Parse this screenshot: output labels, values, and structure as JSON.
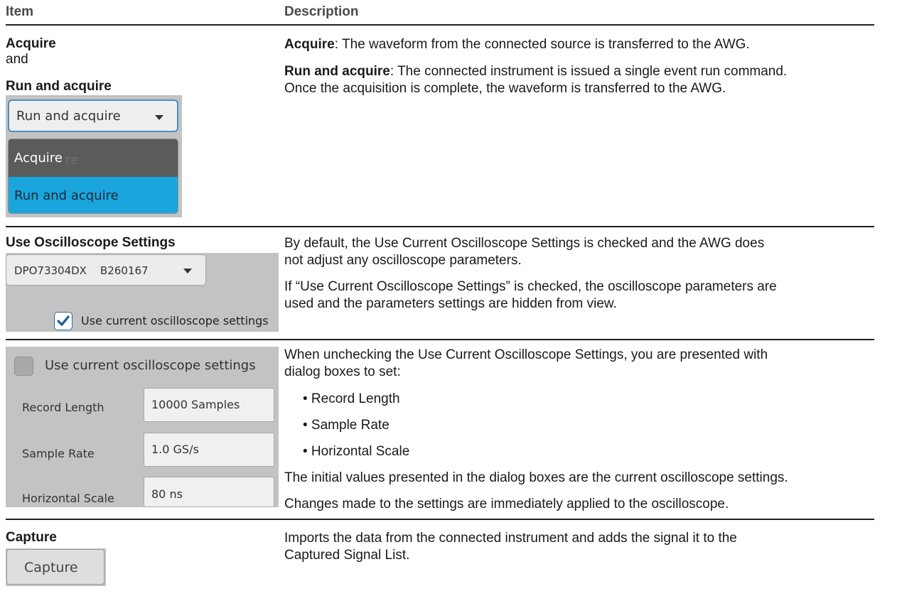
{
  "header": {
    "item": "Item",
    "description": "Description"
  },
  "row1": {
    "title1": "Acquire",
    "and": "and",
    "title2": "Run and acquire",
    "dropdown_value": "Run and acquire",
    "options": [
      "Acquire",
      "Run and acquire"
    ],
    "ghost_text": "re",
    "desc1_bold": "Acquire",
    "desc1_rest": ": The waveform from the connected source is transferred to the AWG.",
    "desc2_bold": "Run and acquire",
    "desc2_line1": ": The connected instrument is issued a single event run command.",
    "desc2_line2": "Once the acquisition is complete, the waveform is transferred to the AWG."
  },
  "row2": {
    "title": "Use Oscilloscope Settings",
    "instrument": "DPO73304DX    B260167",
    "checkbox_label": "Use current oscilloscope settings",
    "checked": true,
    "desc_p1_l1": "By default, the Use Current Oscilloscope Settings is checked and the AWG does",
    "desc_p1_l2": "not adjust any oscilloscope parameters.",
    "desc_p2_l1": "If “Use Current Oscilloscope Settings” is checked, the oscilloscope parameters are",
    "desc_p2_l2": "used and the parameters settings are hidden from view."
  },
  "row3": {
    "checkbox_label": "Use current oscilloscope settings",
    "checked": false,
    "fields": [
      {
        "label": "Record Length",
        "value": "10000 Samples"
      },
      {
        "label": "Sample Rate",
        "value": "1.0 GS/s"
      },
      {
        "label": "Horizontal Scale",
        "value": "80 ns"
      }
    ],
    "desc_l1": "When unchecking the Use Current Oscilloscope Settings, you are presented with",
    "desc_l2": "dialog boxes to set:",
    "bullets": [
      "• Record Length",
      "• Sample Rate",
      "• Horizontal Scale"
    ],
    "desc_p2": "The initial values presented in the dialog boxes are the current oscilloscope settings.",
    "desc_p3": "Changes made to the settings are immediately applied to the oscilloscope."
  },
  "row4": {
    "title": "Capture",
    "button_label": "Capture",
    "desc_l1": "Imports the data from the connected instrument and adds the signal it to the",
    "desc_l2": "Captured Signal List."
  },
  "colors": {
    "accent": "#1aa5dd",
    "accent_border": "#4a8fc7",
    "panel": "#c3c3c3",
    "menu_dark": "#5b5b5b"
  }
}
